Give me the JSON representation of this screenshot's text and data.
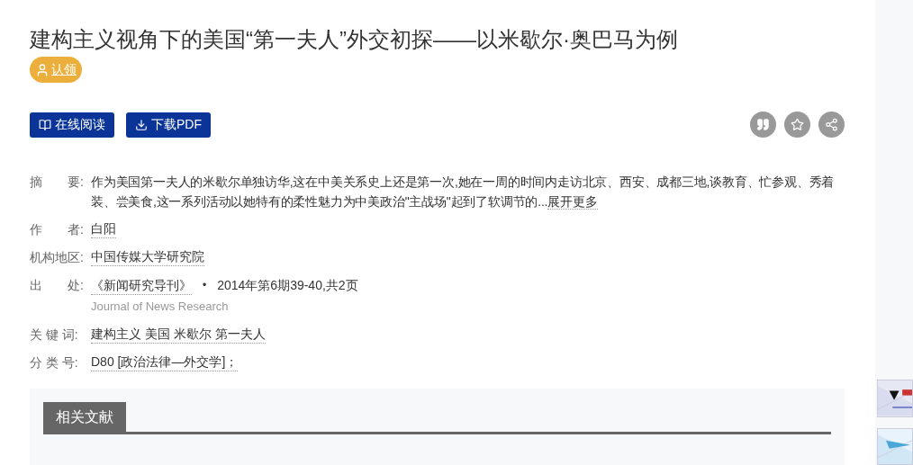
{
  "title": "建构主义视角下的美国“第一夫人”外交初探——以米歇尔·奥巴马为例",
  "claim_button": "认领",
  "actions": [
    {
      "kind": "read",
      "label": "在线阅读"
    },
    {
      "kind": "download",
      "label": "下载PDF"
    }
  ],
  "tools": [
    {
      "kind": "cite"
    },
    {
      "kind": "favorite"
    },
    {
      "kind": "share"
    }
  ],
  "meta": [
    {
      "label": "摘　　要:",
      "kind": "abstract",
      "text": "作为美国第一夫人的米歇尔单独访华,这在中美关系史上还是第一次,她在一周的时间内走访北京、西安、成都三地,谈教育、忙参观、秀着装、尝美食,这一系列活动以她特有的柔性魅力为中美政治\"主战场\"起到了软调节的...",
      "more": "展开更多"
    },
    {
      "label": "作　　者:",
      "kind": "links",
      "links": [
        "白阳"
      ]
    },
    {
      "label": "机构地区:",
      "kind": "links",
      "links": [
        "中国传媒大学研究院"
      ]
    },
    {
      "label": "出　　处:",
      "kind": "source",
      "journal": "《新闻研究导刊》",
      "separator": "•",
      "issue": "2014年第6期39-40,共2页",
      "english": "Journal of News Research"
    },
    {
      "label": "关 键 词:",
      "kind": "links",
      "links": [
        "建构主义 美国 米歇尔 第一夫人"
      ]
    },
    {
      "label": "分 类 号:",
      "kind": "links",
      "links": [
        "D80 [政治法律—外交学]；"
      ]
    }
  ],
  "related": {
    "tab": "相关文献"
  }
}
